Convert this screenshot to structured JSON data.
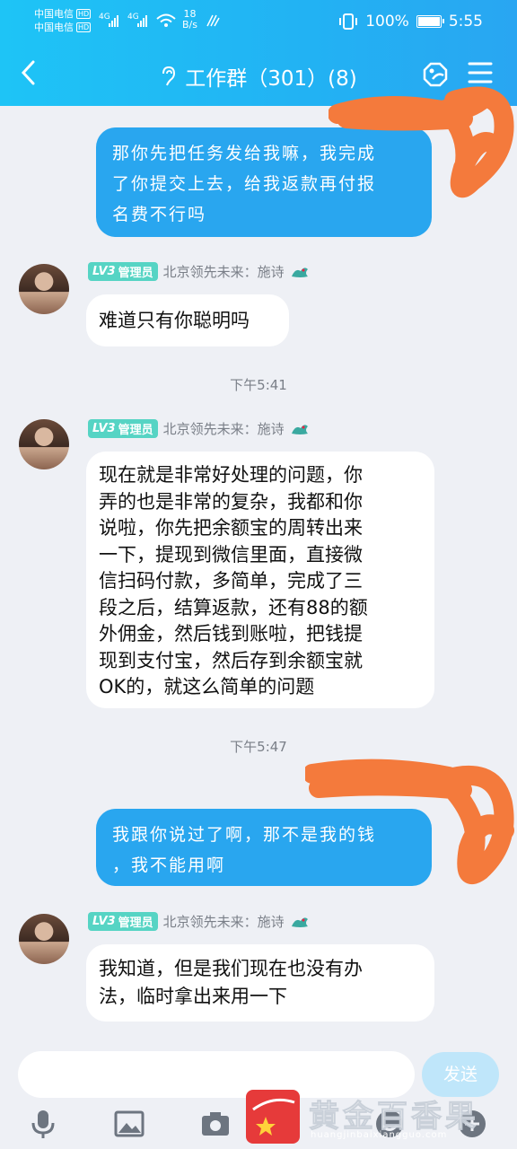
{
  "status_bar": {
    "carrier1": "中国电信",
    "carrier2": "中国电信",
    "hd": "HD",
    "net1": "4G",
    "net2": "4G",
    "speed_value": "18",
    "speed_unit": "B/s",
    "battery": "100%",
    "time": "5:55"
  },
  "header": {
    "title": "工作群（301）(8)",
    "back_icon": "chevron-left-icon",
    "ear_icon": "ear-icon",
    "tag_icon": "tag-link-icon",
    "menu_icon": "menu-icon"
  },
  "messages": [
    {
      "from": "me",
      "text_lines": [
        "那你先把任务发给我嘛，我完成",
        "了你提交上去，给我返款再付报",
        "名费不行吗"
      ]
    },
    {
      "from": "them",
      "level": "LV3",
      "role": "管理员",
      "sender": "北京领先未来：施诗",
      "text_lines": [
        "难道只有你聪明吗"
      ]
    },
    {
      "from": "time",
      "text": "下午5:41"
    },
    {
      "from": "them",
      "level": "LV3",
      "role": "管理员",
      "sender": "北京领先未来：施诗",
      "text_lines": [
        "现在就是非常好处理的问题，你",
        "弄的也是非常的复杂，我都和你",
        "说啦，你先把余额宝的周转出来",
        "一下，提现到微信里面，直接微",
        "信扫码付款，多简单，完成了三",
        "段之后，结算返款，还有88的额",
        "外佣金，然后钱到账啦，把钱提",
        "现到支付宝，然后存到余额宝就",
        "OK的，就这么简单的问题"
      ]
    },
    {
      "from": "time",
      "text": "下午5:47"
    },
    {
      "from": "me",
      "text_lines": [
        "我跟你说过了啊，那不是我的钱",
        "，我不能用啊"
      ]
    },
    {
      "from": "them",
      "level": "LV3",
      "role": "管理员",
      "sender": "北京领先未来：施诗",
      "text_lines": [
        "我知道，但是我们现在也没有办",
        "法，临时拿出来用一下"
      ]
    }
  ],
  "composer": {
    "send_label": "发送",
    "tools": [
      "microphone-icon",
      "image-icon",
      "camera-icon",
      "emoji-icon",
      "plus-icon"
    ]
  },
  "watermark": {
    "text": "黄金百香果",
    "url": "huangjinbaixiangguo.com"
  },
  "colors": {
    "header_start": "#1ec4f6",
    "my_bubble": "#29a6ef",
    "level_badge": "#56d4c4",
    "scribble": "#f47a3c"
  }
}
